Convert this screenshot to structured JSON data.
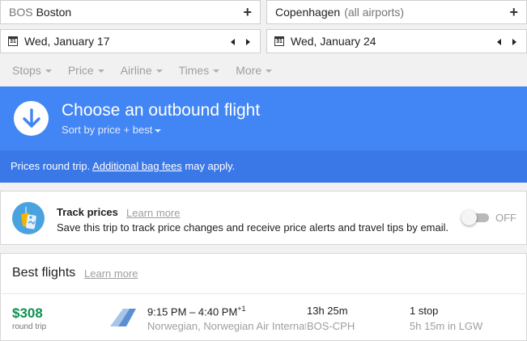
{
  "search": {
    "origin": {
      "code": "BOS",
      "city": "Boston"
    },
    "destination": {
      "city": "Copenhagen",
      "note": "(all airports)"
    },
    "depart_date": "Wed, January 17",
    "return_date": "Wed, January 24",
    "calendar_glyph": "31"
  },
  "filters": [
    "Stops",
    "Price",
    "Airline",
    "Times",
    "More"
  ],
  "banner": {
    "title": "Choose an outbound flight",
    "sort_label": "Sort by price + best",
    "prices_note_start": "Prices round trip.",
    "prices_note_link": "Additional bag fees",
    "prices_note_end": "may apply."
  },
  "track": {
    "title": "Track prices",
    "learn_more": "Learn more",
    "description": "Save this trip to track price changes and receive price alerts and travel tips by email.",
    "toggle_label": "OFF",
    "toggle_on": false
  },
  "best_flights": {
    "title": "Best flights",
    "learn_more": "Learn more",
    "flights": [
      {
        "price": "$308",
        "price_note": "round trip",
        "times": "9:15 PM – 4:40 PM",
        "day_offset": "+1",
        "airline": "Norwegian, Norwegian Air International",
        "duration": "13h 25m",
        "route": "BOS-CPH",
        "stops": "1 stop",
        "layover": "5h 15m in LGW"
      }
    ]
  },
  "colors": {
    "banner": "#4285f4",
    "banner_dark": "#3b78e7",
    "price_green": "#0d904f"
  }
}
